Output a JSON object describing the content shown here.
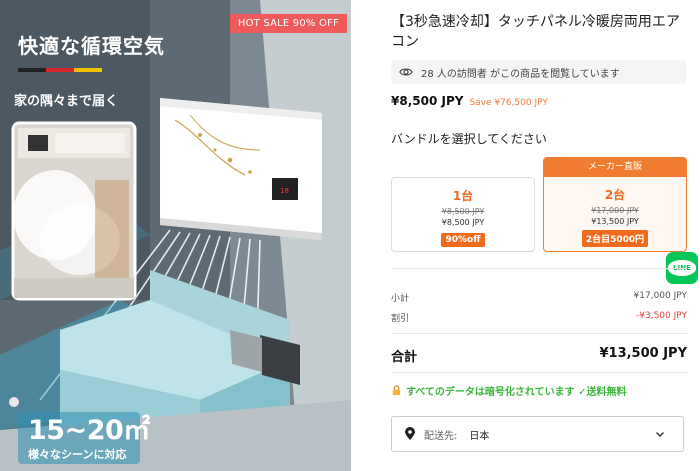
{
  "product_image": {
    "badge": "HOT SALE 90% OFF",
    "headline": "快適な循環空気",
    "subline": "家の隅々まで届く",
    "area_text": "15~20㎡",
    "area_sub": "様々なシーンに対応",
    "flag_colors": [
      "#222222",
      "#d6262b",
      "#f2c200"
    ]
  },
  "product": {
    "title": "【3秒急速冷却】タッチパネル冷暖房両用エアコン",
    "viewers_text": "28 人の訪問者 がこの商品を閲覧しています",
    "price": "¥8,500 JPY",
    "save": "Save ¥76,500 JPY"
  },
  "bundle": {
    "label": "バンドルを選択してください",
    "options": [
      {
        "qty": "1台",
        "old_price": "¥8,500 JPY",
        "new_price": "¥8,500 JPY",
        "deal": "90%off",
        "header": ""
      },
      {
        "qty": "2台",
        "old_price": "¥17,000 JPY",
        "new_price": "¥13,500 JPY",
        "deal": "2台目5000円",
        "header": "メーカー直販"
      }
    ]
  },
  "line_button": {
    "label": "LINE"
  },
  "summary": {
    "subtotal_label": "小計",
    "subtotal_value": "¥17,000 JPY",
    "discount_label": "割引",
    "discount_value": "-¥3,500 JPY",
    "total_label": "合計",
    "total_value": "¥13,500 JPY"
  },
  "secure_text": "すべてのデータは暗号化されています ✓送料無料",
  "shipping": {
    "label": "配送先:",
    "value": "日本"
  },
  "colors": {
    "accent_orange": "#f07d2f",
    "discount_red": "#e0413a",
    "secure_green": "#3bb53b",
    "line_green": "#06c755"
  }
}
